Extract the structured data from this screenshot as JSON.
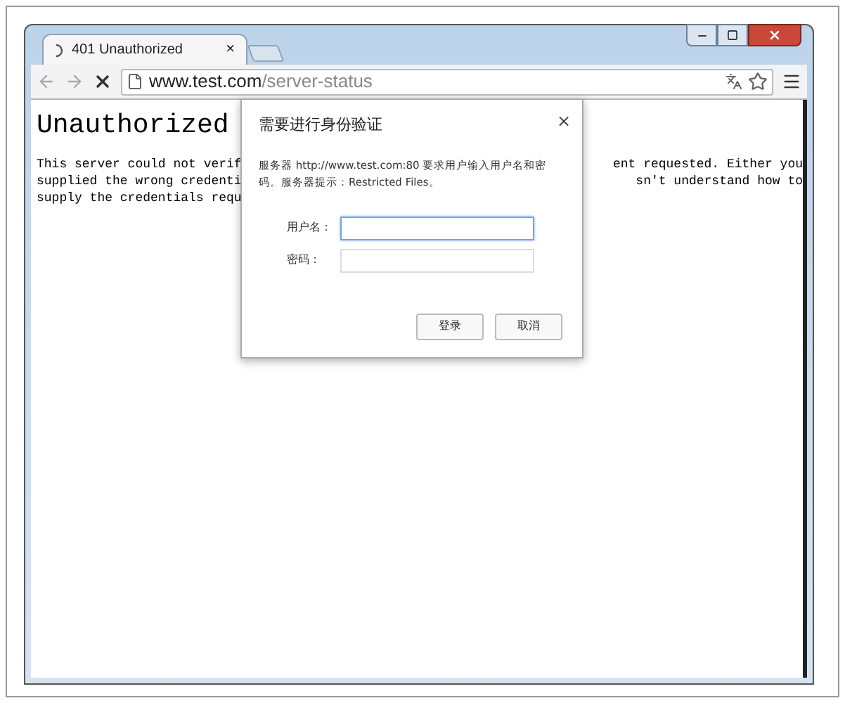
{
  "tabs": [
    {
      "title": "401 Unauthorized",
      "selected": true,
      "loading": true,
      "close": "×"
    }
  ],
  "address_bar": {
    "host": "www.test.com",
    "path": "/server-status"
  },
  "page": {
    "heading": "Unauthorized",
    "lines": [
      {
        "left": "This server could not verif",
        "right": "ent requested. Either you"
      },
      {
        "left": "supplied the wrong credenti",
        "right": "sn't understand how to"
      },
      {
        "left": "supply the credentials requ"
      }
    ]
  },
  "dialog": {
    "title": "需要进行身份验证",
    "close": "×",
    "message": "服务器 http://www.test.com:80 要求用户输入用户名和密码。服务器提示：Restricted Files。",
    "fields": [
      {
        "label": "用户名：",
        "focused": true
      },
      {
        "label": "密码：",
        "focused": false
      }
    ],
    "buttons": [
      {
        "label": "登录"
      },
      {
        "label": "取消"
      }
    ]
  }
}
